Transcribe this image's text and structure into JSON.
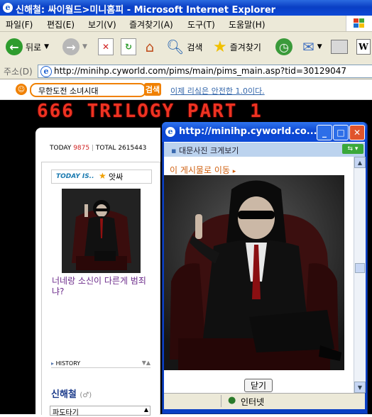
{
  "window": {
    "title": "신해철: 싸이월드>미니홈피 - Microsoft Internet Explorer"
  },
  "menu": [
    "파일(F)",
    "편집(E)",
    "보기(V)",
    "즐겨찾기(A)",
    "도구(T)",
    "도움말(H)"
  ],
  "toolbar": {
    "back_label": "뒤로",
    "search_label": "검색",
    "favorites_label": "즐겨찾기"
  },
  "address": {
    "label": "주소(D)",
    "url": "http://minihp.cyworld.com/pims/main/pims_main.asp?tid=30129047"
  },
  "site": {
    "search_value": "무한도전 소녀시대",
    "search_button": "검색",
    "safe_link": "이제 리싴은 안전한 1.0이다.",
    "banner": "666 TRILOGY PART 1",
    "today_label": "TODAY",
    "today_count": "9875",
    "total_label": "TOTAL",
    "total_count": "2615443",
    "today_is_label": "TODAY IS..",
    "mood": "앗싸",
    "caption": "너네랑 소신이 다른게 범죄냐?",
    "history_label": "HISTORY",
    "owner_name": "신해철",
    "owner_gender": "(♂)",
    "dropdown_value": "파도타기"
  },
  "popup": {
    "title": "http://minihp.cyworld.co...",
    "header": "대문사진 크게보기",
    "goto_link": "이 게시물로 이동",
    "close_button": "닫기",
    "status_zone": "인터넷"
  },
  "colors": {
    "xp_blue": "#0a3fc4",
    "accent_orange": "#f08000",
    "banner_red": "#ee3322"
  }
}
